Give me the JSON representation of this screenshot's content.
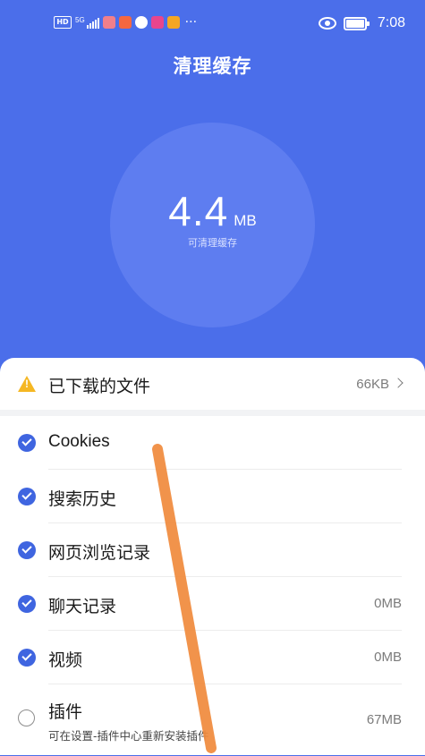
{
  "status_bar": {
    "network": "5G",
    "hd": "HD",
    "overflow": "···",
    "time": "7:08",
    "app_icon_colors": [
      "#f07f8b",
      "#f5673f",
      "#ffffff",
      "#e8458d",
      "#f5a623"
    ]
  },
  "header": {
    "title": "清理缓存",
    "cache_value": "4.4",
    "cache_unit": "MB",
    "cache_label": "可清理缓存"
  },
  "downloads": {
    "label": "已下载的文件",
    "size": "66KB",
    "icon": "warning-icon"
  },
  "items": [
    {
      "label": "Cookies",
      "size": "",
      "checked": true
    },
    {
      "label": "搜索历史",
      "size": "",
      "checked": true
    },
    {
      "label": "网页浏览记录",
      "size": "",
      "checked": true
    },
    {
      "label": "聊天记录",
      "size": "0MB",
      "checked": true
    },
    {
      "label": "视频",
      "size": "0MB",
      "checked": true
    },
    {
      "label": "插件",
      "size": "67MB",
      "checked": false,
      "sub": "可在设置-插件中心重新安装插件"
    }
  ],
  "colors": {
    "primary": "#4b6eea",
    "circle": "#5e7df0",
    "check": "#3f65e0",
    "warning": "#f5b723",
    "annotation": "#f08a3c"
  }
}
